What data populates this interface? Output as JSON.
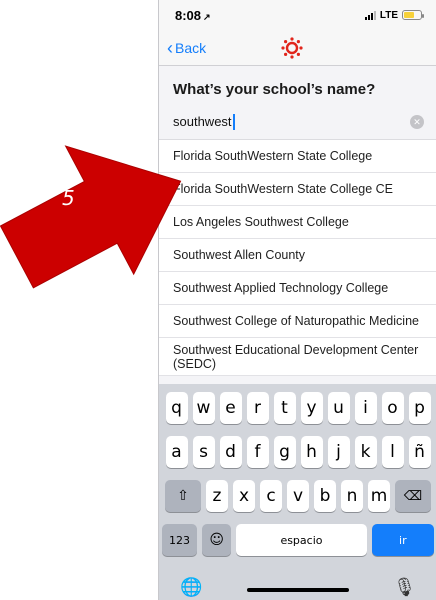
{
  "annotation": {
    "step_number": "5",
    "arrow_color": "#cc0000"
  },
  "status_bar": {
    "time": "8:08",
    "location_glyph": "↗",
    "network": "LTE"
  },
  "nav": {
    "back_label": "Back",
    "logo_color": "#e1251b"
  },
  "page": {
    "title": "What’s your school’s name?"
  },
  "search": {
    "value": "southwest",
    "clear_glyph": "✕"
  },
  "results": [
    "Florida SouthWestern State College",
    "Florida SouthWestern State College CE",
    "Los Angeles Southwest College",
    "Southwest Allen County",
    "Southwest Applied Technology College",
    "Southwest College of Naturopathic Medicine",
    "Southwest Educational Development Center (SEDC)"
  ],
  "keyboard": {
    "row1": [
      "q",
      "w",
      "e",
      "r",
      "t",
      "y",
      "u",
      "i",
      "o",
      "p"
    ],
    "row2": [
      "a",
      "s",
      "d",
      "f",
      "g",
      "h",
      "j",
      "k",
      "l",
      "ñ"
    ],
    "row3": [
      "z",
      "x",
      "c",
      "v",
      "b",
      "n",
      "m"
    ],
    "shift_glyph": "⇧",
    "delete_glyph": "⌫",
    "numbers_label": "123",
    "emoji_glyph": "☺",
    "space_label": "espacio",
    "go_label": "ir",
    "globe_glyph": "🌐",
    "mic_glyph": "🎙",
    "accent_color": "#147efb"
  }
}
